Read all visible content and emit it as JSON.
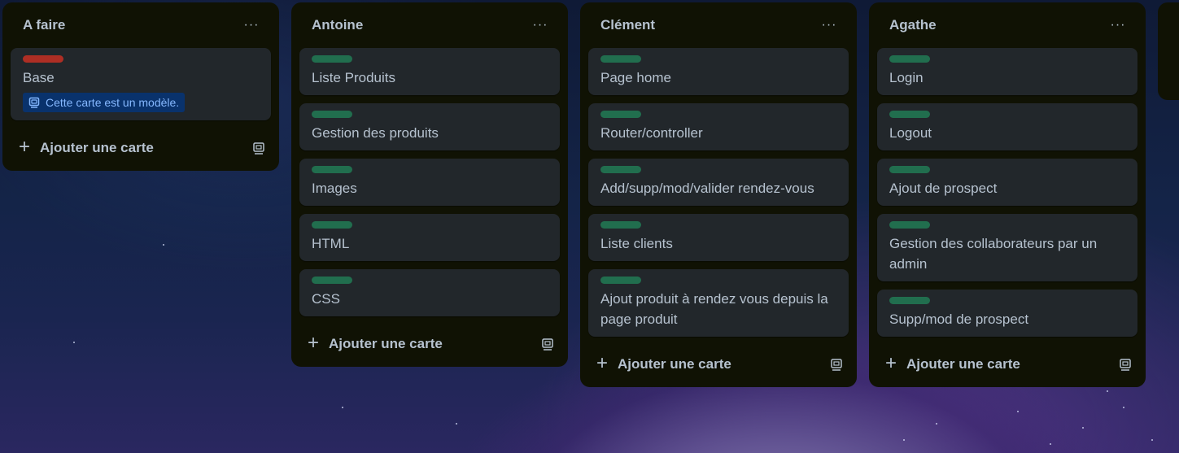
{
  "board": {
    "lists": [
      {
        "title": "A faire",
        "cards": [
          {
            "label_color": "red",
            "title": "Base",
            "badge": "Cette carte est un modèle."
          }
        ],
        "add_card_label": "Ajouter une carte"
      },
      {
        "title": "Antoine",
        "cards": [
          {
            "label_color": "green",
            "title": "Liste Produits"
          },
          {
            "label_color": "green",
            "title": "Gestion des produits"
          },
          {
            "label_color": "green",
            "title": "Images"
          },
          {
            "label_color": "green",
            "title": "HTML"
          },
          {
            "label_color": "green",
            "title": "CSS"
          }
        ],
        "add_card_label": "Ajouter une carte"
      },
      {
        "title": "Clément",
        "cards": [
          {
            "label_color": "green",
            "title": "Page home"
          },
          {
            "label_color": "green",
            "title": "Router/controller"
          },
          {
            "label_color": "green",
            "title": "Add/supp/mod/valider rendez-vous"
          },
          {
            "label_color": "green",
            "title": "Liste clients"
          },
          {
            "label_color": "green",
            "title": "Ajout produit à rendez vous depuis la page produit"
          }
        ],
        "add_card_label": "Ajouter une carte"
      },
      {
        "title": "Agathe",
        "cards": [
          {
            "label_color": "green",
            "title": "Login"
          },
          {
            "label_color": "green",
            "title": "Logout"
          },
          {
            "label_color": "green",
            "title": "Ajout de prospect"
          },
          {
            "label_color": "green",
            "title": "Gestion des collaborateurs par un admin"
          },
          {
            "label_color": "green",
            "title": "Supp/mod de prospect"
          }
        ],
        "add_card_label": "Ajouter une carte"
      }
    ],
    "menu_glyph": "···",
    "plus_glyph": "+"
  },
  "colors": {
    "list_bg": "#101204",
    "card_bg": "#22272b",
    "label_green": "#216e4e",
    "label_red": "#ae2e24",
    "badge_bg": "#09326c",
    "badge_text": "#85b8ff",
    "text": "#b6c2cf"
  }
}
